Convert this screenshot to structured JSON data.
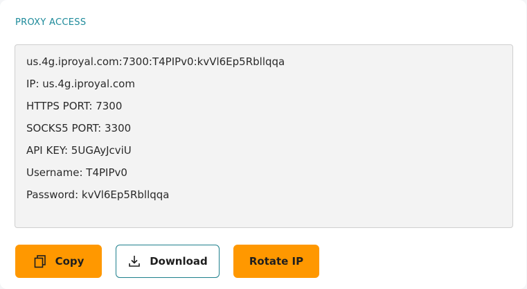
{
  "section": {
    "title": "PROXY ACCESS"
  },
  "credentials": {
    "lines": [
      "us.4g.iproyal.com:7300:T4PIPv0:kvVl6Ep5Rbllqqa",
      "IP: us.4g.iproyal.com",
      "HTTPS PORT: 7300",
      "SOCKS5 PORT: 3300",
      "API KEY: 5UGAyJcviU",
      "Username: T4PIPv0",
      "Password: kvVl6Ep5Rbllqqa"
    ]
  },
  "actions": {
    "copy_label": "Copy",
    "download_label": "Download",
    "rotate_label": "Rotate IP"
  },
  "colors": {
    "accent_orange": "#ff9800",
    "title_teal": "#1d8a9a",
    "outline_teal": "#1d7f8c"
  },
  "icons": {
    "copy": "copy-icon",
    "download": "download-icon"
  }
}
